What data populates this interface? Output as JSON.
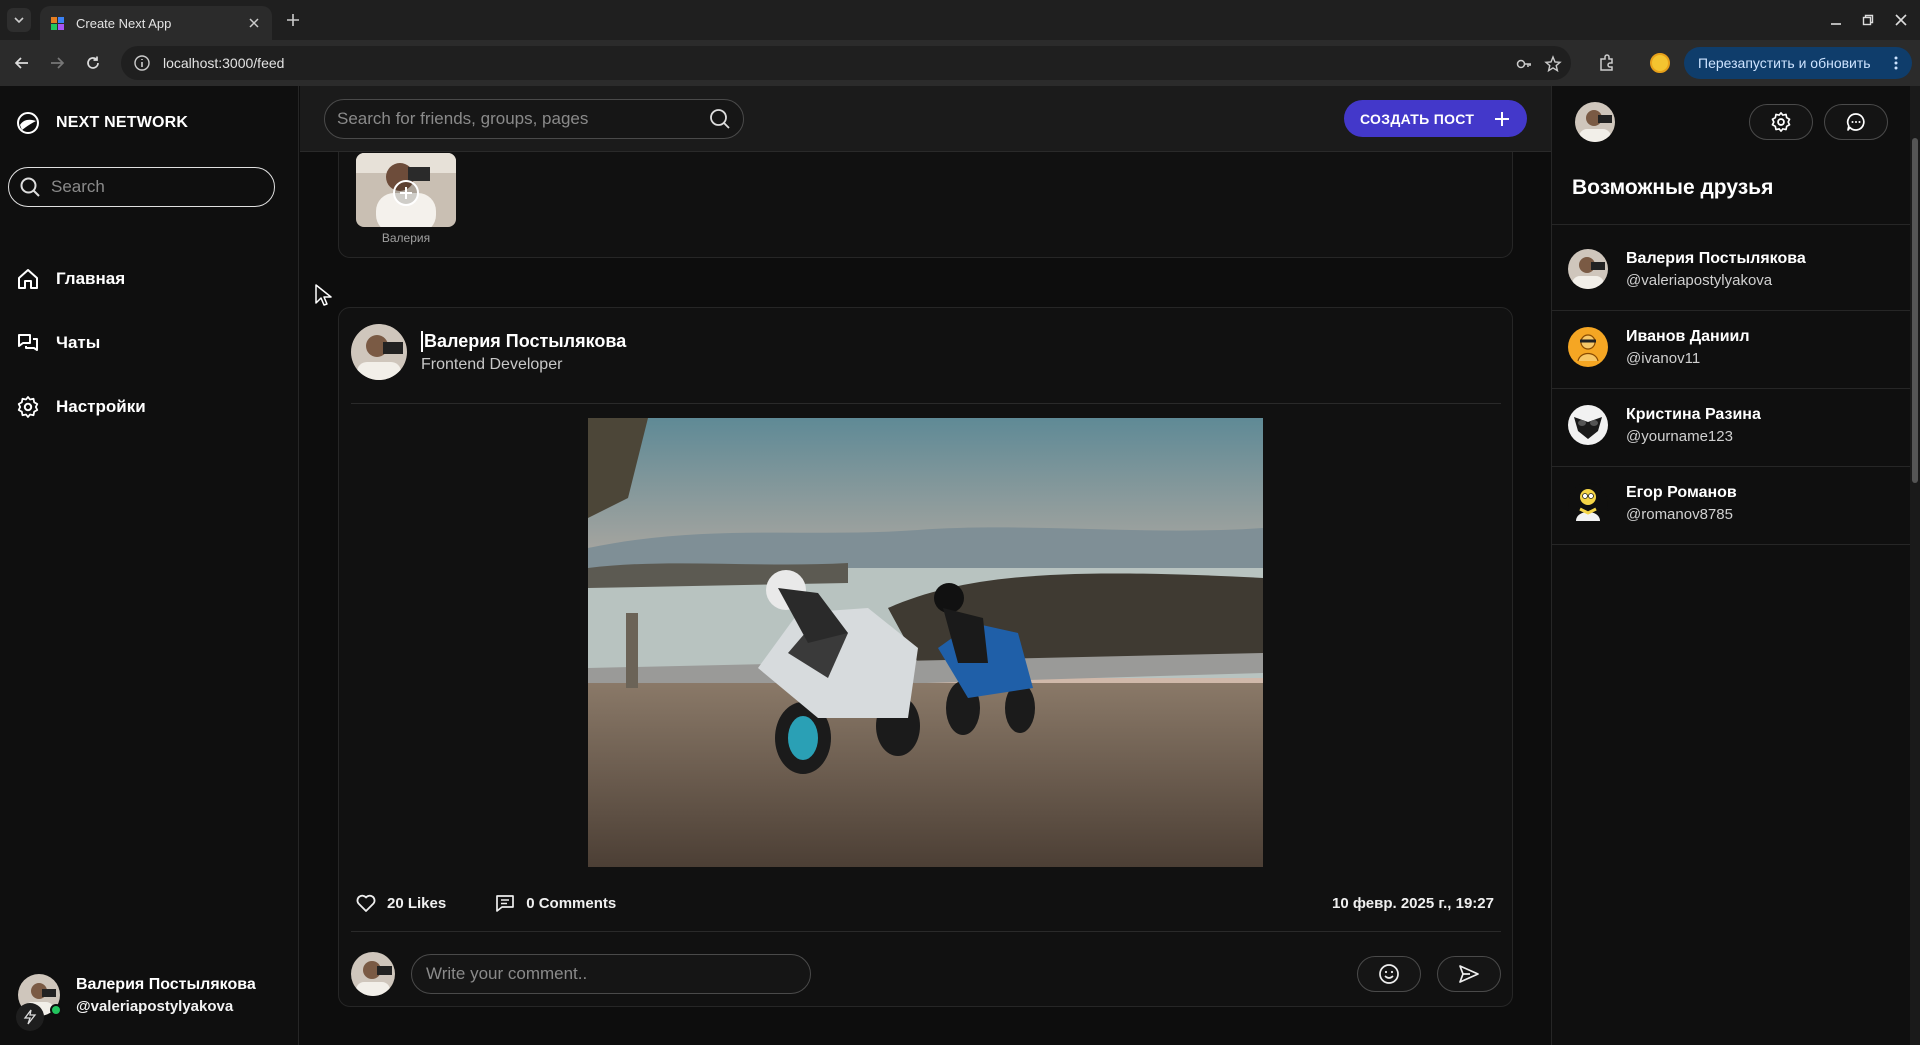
{
  "browser": {
    "tab_title": "Create Next App",
    "url": "localhost:3000/feed",
    "relaunch_label": "Перезапустить и обновить"
  },
  "sidebar": {
    "brand": "NEXT NETWORK",
    "search_placeholder": "Search",
    "nav": [
      {
        "label": "Главная",
        "icon": "home-icon"
      },
      {
        "label": "Чаты",
        "icon": "chats-icon"
      },
      {
        "label": "Настройки",
        "icon": "gear-icon"
      }
    ],
    "user": {
      "name": "Валерия Постылякова",
      "handle": "@valeriapostylyakova"
    }
  },
  "header": {
    "search_placeholder": "Search for friends, groups, pages",
    "create_label": "СОЗДАТЬ ПОСТ"
  },
  "stories": [
    {
      "name": "Валерия"
    }
  ],
  "post": {
    "author": "Валерия Постылякова",
    "role": "Frontend Developer",
    "likes_label": "20 Likes",
    "comments_label": "0 Comments",
    "date": "10 февр. 2025 г., 19:27",
    "comment_placeholder": "Write your comment.."
  },
  "rightbar": {
    "title": "Возможные друзья",
    "friends": [
      {
        "name": "Валерия Постылякова",
        "handle": "@valeriapostylyakova"
      },
      {
        "name": "Иванов Даниил",
        "handle": "@ivanov11"
      },
      {
        "name": "Кристина Разина",
        "handle": "@yourname123"
      },
      {
        "name": "Егор Романов",
        "handle": "@romanov8785"
      }
    ]
  },
  "colors": {
    "accent": "#4338ca",
    "online": "#22c55e",
    "relaunch_bg": "#0f3d6b"
  }
}
